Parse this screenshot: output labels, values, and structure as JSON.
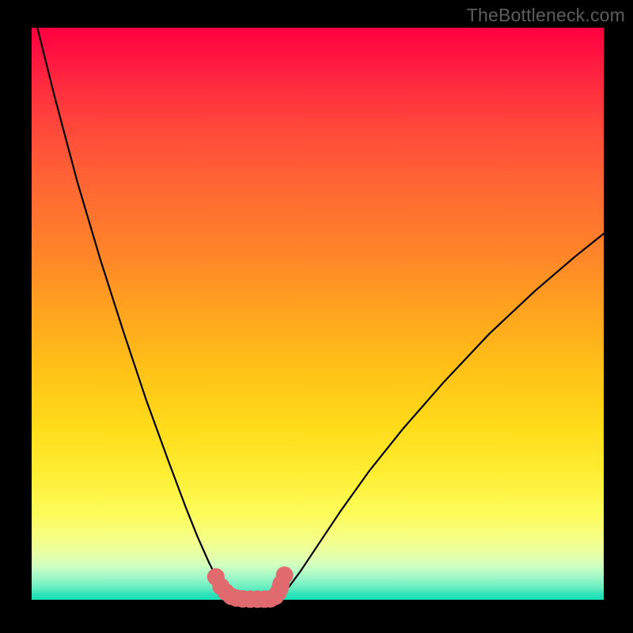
{
  "watermark": "TheBottleneck.com",
  "chart_data": {
    "type": "line",
    "title": "",
    "xlabel": "",
    "ylabel": "",
    "xlim": [
      0,
      100
    ],
    "ylim": [
      0,
      100
    ],
    "grid": false,
    "series": [
      {
        "name": "left-curve",
        "color": "#000000",
        "x": [
          1,
          4,
          8,
          12,
          16,
          20,
          24,
          27,
          29,
          31,
          32.5,
          33.6,
          34.4,
          35,
          35.5
        ],
        "y": [
          100,
          88,
          73,
          59.5,
          47,
          35,
          24,
          16,
          11,
          6.5,
          3.5,
          1.8,
          0.8,
          0.3,
          0.15
        ]
      },
      {
        "name": "flat-valley",
        "color": "#000000",
        "x": [
          35.5,
          37,
          39,
          41,
          42.3
        ],
        "y": [
          0.15,
          0.1,
          0.1,
          0.1,
          0.15
        ]
      },
      {
        "name": "right-curve",
        "color": "#000000",
        "x": [
          42.3,
          43.5,
          45,
          47,
          50,
          54,
          59,
          65,
          72,
          80,
          88,
          95,
          100
        ],
        "y": [
          0.15,
          0.8,
          2.3,
          5,
          9.5,
          15.5,
          22.5,
          30,
          38,
          46.5,
          54,
          60,
          64
        ]
      },
      {
        "name": "valley-markers",
        "type": "scatter",
        "color": "#e06a6d",
        "x": [
          32.2,
          33.1,
          34.0,
          34.9,
          35.8,
          36.9,
          38.2,
          39.5,
          40.7,
          41.7,
          42.6,
          43.1,
          43.4,
          43.6,
          44.2
        ],
        "y": [
          4.0,
          2.3,
          1.3,
          0.6,
          0.3,
          0.15,
          0.1,
          0.1,
          0.1,
          0.15,
          0.6,
          1.3,
          2.0,
          2.8,
          4.3
        ]
      }
    ]
  }
}
